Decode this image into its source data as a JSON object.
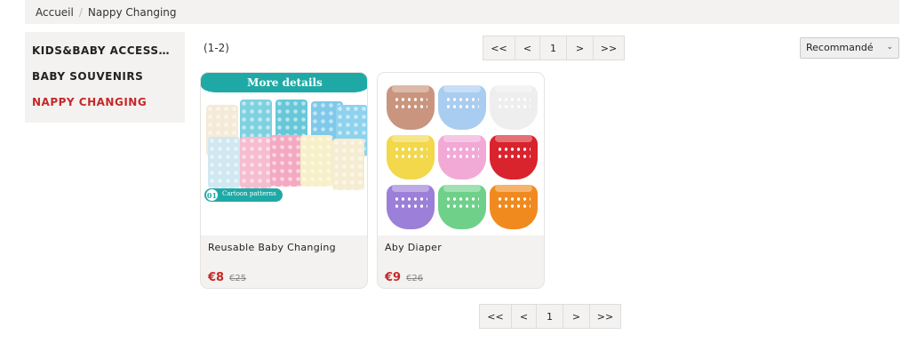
{
  "breadcrumb": {
    "home": "Accueil",
    "separator": "/",
    "current": "Nappy Changing"
  },
  "sidebar": {
    "categories": [
      {
        "label": "KIDS&BABY ACCESSORIES"
      },
      {
        "label": "BABY SOUVENIRS"
      },
      {
        "label": "NAPPY CHANGING"
      }
    ]
  },
  "results": {
    "count": "(1-2)"
  },
  "pagination": {
    "first": "<<",
    "prev": "<",
    "page": "1",
    "next": ">",
    "last": ">>"
  },
  "sort": {
    "selected": "Recommandé"
  },
  "products": [
    {
      "title": "Reusable Baby Changing",
      "price": "€8",
      "old_price": "€25",
      "image": {
        "banner": "More details",
        "tag_number": "01",
        "tag_text": "Cartoon patterns"
      }
    },
    {
      "title": "Aby Diaper",
      "price": "€9",
      "old_price": "€26",
      "image": {
        "colors": [
          "#c9957e",
          "#a9cdf0",
          "#eeeeee",
          "#f2d84a",
          "#f2a9d6",
          "#d9232d",
          "#9b7fd8",
          "#6fd08a",
          "#f08a1f"
        ]
      }
    }
  ],
  "colors": {
    "accent": "#c62828",
    "panel": "#f3f2f0",
    "teal": "#1fa9a6"
  }
}
